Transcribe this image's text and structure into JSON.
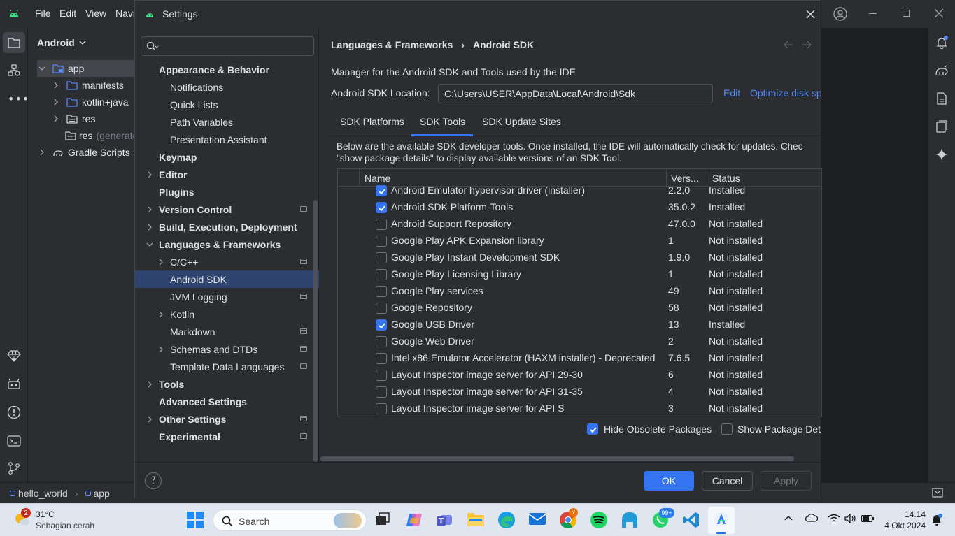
{
  "ide": {
    "menu": [
      "File",
      "Edit",
      "View",
      "Navi"
    ],
    "project_selector": "Android",
    "tree": [
      {
        "label": "app",
        "indent": 0
      },
      {
        "label": "manifests",
        "indent": 1
      },
      {
        "label": "kotlin+java",
        "indent": 1
      },
      {
        "label": "res",
        "indent": 1
      },
      {
        "label": "res",
        "suffix": "(generate",
        "indent": 1
      },
      {
        "label": "Gradle Scripts",
        "indent": 0
      }
    ],
    "breadcrumb": [
      "hello_world",
      "app"
    ]
  },
  "dialog": {
    "title": "Settings",
    "search_placeholder": "",
    "nav": [
      {
        "label": "Appearance & Behavior",
        "bold": true
      },
      {
        "label": "Notifications"
      },
      {
        "label": "Quick Lists"
      },
      {
        "label": "Path Variables"
      },
      {
        "label": "Presentation Assistant"
      },
      {
        "label": "Keymap",
        "bold": true
      },
      {
        "label": "Editor",
        "bold": true
      },
      {
        "label": "Plugins",
        "bold": true
      },
      {
        "label": "Version Control",
        "bold": true
      },
      {
        "label": "Build, Execution, Deployment",
        "bold": true
      },
      {
        "label": "Languages & Frameworks",
        "bold": true
      },
      {
        "label": "C/C++"
      },
      {
        "label": "Android SDK",
        "selected": true
      },
      {
        "label": "JVM Logging"
      },
      {
        "label": "Kotlin"
      },
      {
        "label": "Markdown"
      },
      {
        "label": "Schemas and DTDs"
      },
      {
        "label": "Template Data Languages"
      },
      {
        "label": "Tools",
        "bold": true
      },
      {
        "label": "Advanced Settings",
        "bold": true
      },
      {
        "label": "Other Settings",
        "bold": true
      },
      {
        "label": "Experimental",
        "bold": true
      }
    ],
    "breadcrumb": [
      "Languages & Frameworks",
      "Android SDK"
    ],
    "description": "Manager for the Android SDK and Tools used by the IDE",
    "sdk_location_label": "Android SDK Location:",
    "sdk_location_value": "C:\\Users\\USER\\AppData\\Local\\Android\\Sdk",
    "edit_link": "Edit",
    "optimize_link": "Optimize disk sp",
    "tabs": [
      "SDK Platforms",
      "SDK Tools",
      "SDK Update Sites"
    ],
    "active_tab": "SDK Tools",
    "info_line1": "Below are the available SDK developer tools. Once installed, the IDE will automatically check for updates. Chec",
    "info_line2": "\"show package details\" to display available versions of an SDK Tool.",
    "columns": {
      "name": "Name",
      "version": "Vers...",
      "status": "Status"
    },
    "rows": [
      {
        "checked": true,
        "name": "Android Emulator hypervisor driver (installer)",
        "version": "2.2.0",
        "status": "Installed"
      },
      {
        "checked": true,
        "name": "Android SDK Platform-Tools",
        "version": "35.0.2",
        "status": "Installed"
      },
      {
        "checked": false,
        "name": "Android Support Repository",
        "version": "47.0.0",
        "status": "Not installed"
      },
      {
        "checked": false,
        "name": "Google Play APK Expansion library",
        "version": "1",
        "status": "Not installed"
      },
      {
        "checked": false,
        "name": "Google Play Instant Development SDK",
        "version": "1.9.0",
        "status": "Not installed"
      },
      {
        "checked": false,
        "name": "Google Play Licensing Library",
        "version": "1",
        "status": "Not installed"
      },
      {
        "checked": false,
        "name": "Google Play services",
        "version": "49",
        "status": "Not installed"
      },
      {
        "checked": false,
        "name": "Google Repository",
        "version": "58",
        "status": "Not installed"
      },
      {
        "checked": true,
        "name": "Google USB Driver",
        "version": "13",
        "status": "Installed"
      },
      {
        "checked": false,
        "name": "Google Web Driver",
        "version": "2",
        "status": "Not installed"
      },
      {
        "checked": false,
        "name": "Intel x86 Emulator Accelerator (HAXM installer) - Deprecated",
        "version": "7.6.5",
        "status": "Not installed"
      },
      {
        "checked": false,
        "name": "Layout Inspector image server for API 29-30",
        "version": "6",
        "status": "Not installed"
      },
      {
        "checked": false,
        "name": "Layout Inspector image server for API 31-35",
        "version": "4",
        "status": "Not installed"
      },
      {
        "checked": false,
        "name": "Layout Inspector image server for API S",
        "version": "3",
        "status": "Not installed"
      }
    ],
    "hide_obsolete_label": "Hide Obsolete Packages",
    "hide_obsolete_checked": true,
    "show_details_label": "Show Package Deta",
    "show_details_checked": false,
    "buttons": {
      "ok": "OK",
      "cancel": "Cancel",
      "apply": "Apply"
    },
    "help": "?"
  },
  "taskbar": {
    "weather_temp": "31°C",
    "weather_desc": "Sebagian cerah",
    "weather_badge": "2",
    "search_placeholder": "Search",
    "whatsapp_badge": "99+",
    "chrome_badge": "Y",
    "time": "14.14",
    "date": "4 Okt 2024"
  },
  "colors": {
    "accent": "#3574f0",
    "selected": "#2e436e",
    "link": "#548af7"
  }
}
